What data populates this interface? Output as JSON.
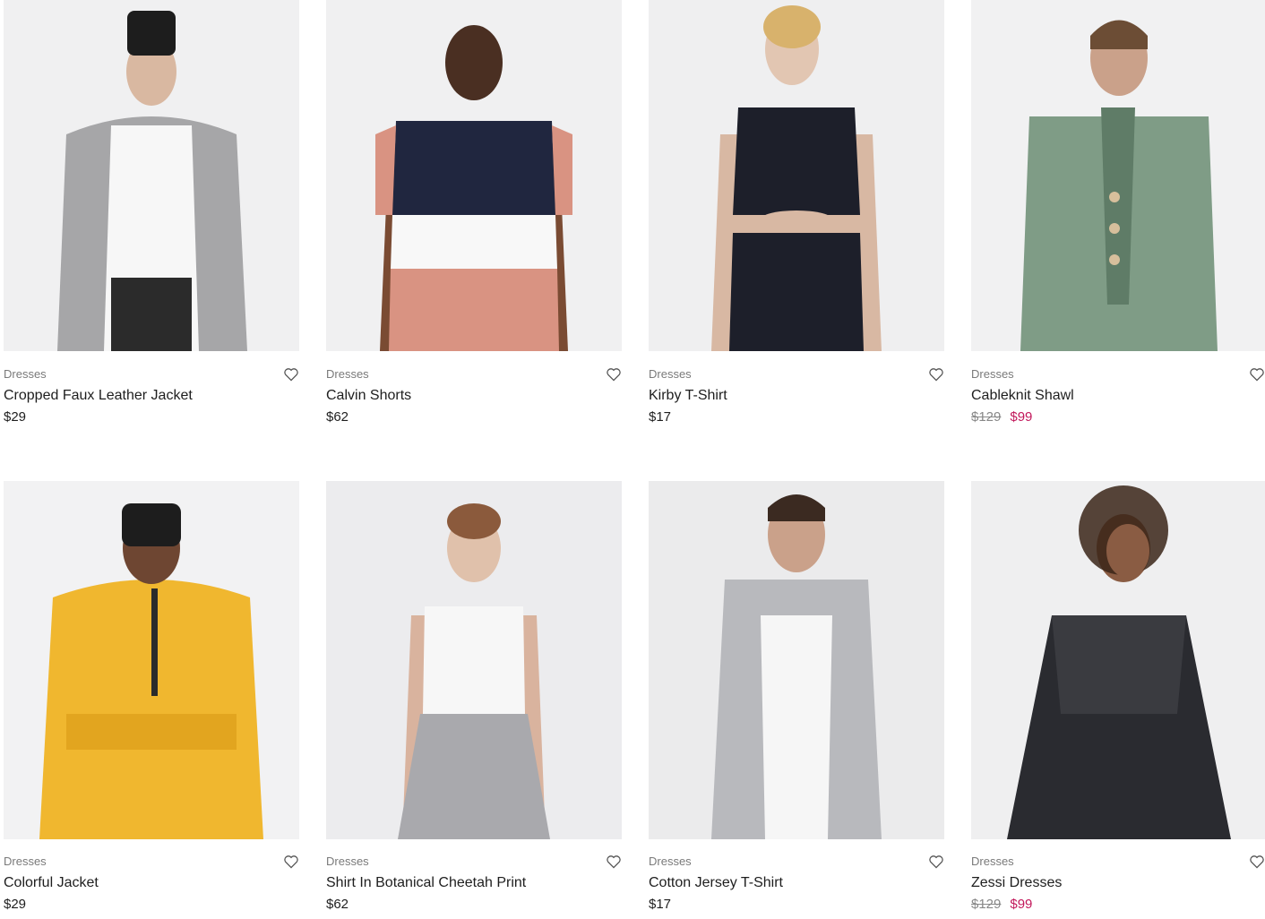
{
  "products": [
    {
      "category": "Dresses",
      "title": "Cropped Faux Leather Jacket",
      "price": "$29",
      "old_price": "",
      "sale_price": "",
      "icon": "heart-icon"
    },
    {
      "category": "Dresses",
      "title": "Calvin Shorts",
      "price": "$62",
      "old_price": "",
      "sale_price": "",
      "icon": "heart-icon"
    },
    {
      "category": "Dresses",
      "title": "Kirby T-Shirt",
      "price": "$17",
      "old_price": "",
      "sale_price": "",
      "icon": "heart-icon"
    },
    {
      "category": "Dresses",
      "title": "Cableknit Shawl",
      "price": "",
      "old_price": "$129",
      "sale_price": "$99",
      "icon": "heart-icon"
    },
    {
      "category": "Dresses",
      "title": "Colorful Jacket",
      "price": "$29",
      "old_price": "",
      "sale_price": "",
      "icon": "heart-icon"
    },
    {
      "category": "Dresses",
      "title": "Shirt In Botanical Cheetah Print",
      "price": "$62",
      "old_price": "",
      "sale_price": "",
      "icon": "heart-icon"
    },
    {
      "category": "Dresses",
      "title": "Cotton Jersey T-Shirt",
      "price": "$17",
      "old_price": "",
      "sale_price": "",
      "icon": "heart-icon"
    },
    {
      "category": "Dresses",
      "title": "Zessi Dresses",
      "price": "",
      "old_price": "$129",
      "sale_price": "$99",
      "icon": "heart-icon"
    }
  ],
  "colors": {
    "sale_price": "#c2185b",
    "text": "#1e1e1e",
    "muted": "#7a7a7a",
    "photo_bg": "#efeff0"
  }
}
